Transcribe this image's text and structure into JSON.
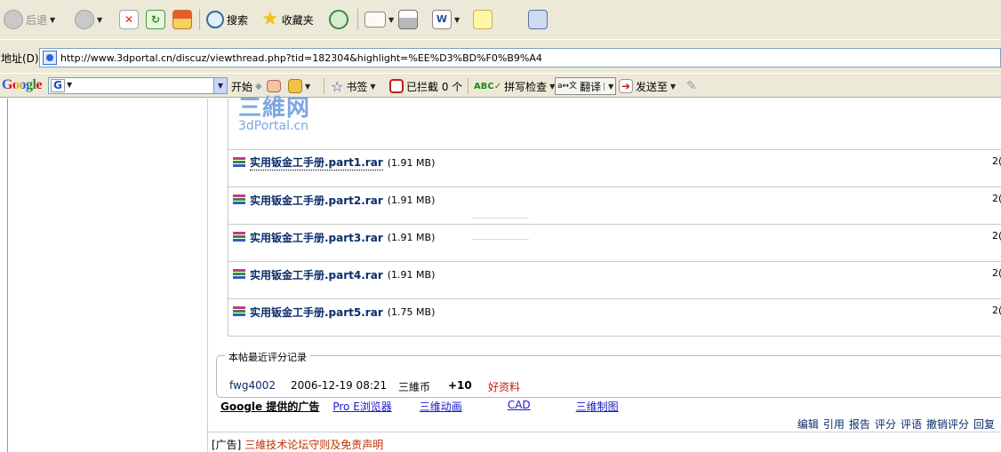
{
  "toolbar": {
    "back_label": "后退",
    "search_label": "搜索",
    "favorites_label": "收藏夹"
  },
  "address": {
    "label": "地址(D)",
    "url": "http://www.3dportal.cn/discuz/viewthread.php?tid=182304&highlight=%EE%D3%BD%F0%B9%A4"
  },
  "google_bar": {
    "logo": "Google",
    "search_icon_letter": "G",
    "start_label": "开始",
    "bookmarks_label": "书签",
    "blocked_label": "已拦截 0 个",
    "spellcheck_label": "拼写检查",
    "translate_label": "翻译",
    "sendto_label": "发送至"
  },
  "page": {
    "logo_text_cn": "三維网",
    "logo_text_en": "3dPortal.cn",
    "attachments": [
      {
        "name": "实用钣金工手册.part1.rar",
        "size": "(1.91 MB)",
        "clip": "2("
      },
      {
        "name": "实用钣金工手册.part2.rar",
        "size": "(1.91 MB)",
        "clip": "2("
      },
      {
        "name": "实用钣金工手册.part3.rar",
        "size": "(1.91 MB)",
        "clip": "2("
      },
      {
        "name": "实用钣金工手册.part4.rar",
        "size": "(1.91 MB)",
        "clip": "2("
      },
      {
        "name": "实用钣金工手册.part5.rar",
        "size": "(1.75 MB)",
        "clip": "2("
      }
    ],
    "rating": {
      "legend": "本帖最近评分记录",
      "user": "fwg4002",
      "time": "2006-12-19 08:21",
      "currency": "三維币",
      "score": "+10",
      "reason": "好资料"
    },
    "ads": {
      "title": "Google 提供的广告",
      "links": [
        "Pro E浏览器",
        "三维动画",
        "CAD",
        "三维制图"
      ]
    },
    "post_actions": [
      "编辑",
      "引用",
      "报告",
      "评分",
      "评语",
      "撤销评分",
      "回复"
    ],
    "footer": {
      "prefix": "[广告]",
      "link": "三維技术论坛守则及免责声明"
    }
  }
}
